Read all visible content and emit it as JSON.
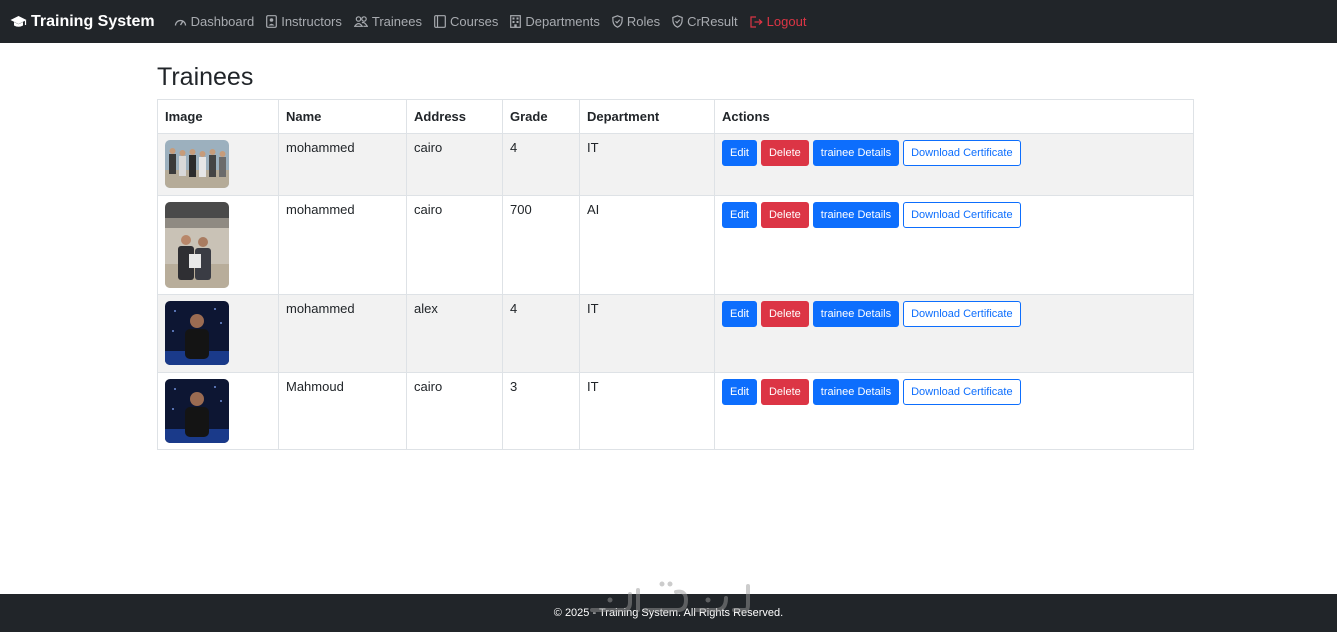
{
  "navbar": {
    "brand": "Training System",
    "items": [
      {
        "label": "Dashboard",
        "icon": "speedometer-icon"
      },
      {
        "label": "Instructors",
        "icon": "person-badge-icon"
      },
      {
        "label": "Trainees",
        "icon": "people-icon"
      },
      {
        "label": "Courses",
        "icon": "book-icon"
      },
      {
        "label": "Departments",
        "icon": "building-icon"
      },
      {
        "label": "Roles",
        "icon": "shield-icon"
      },
      {
        "label": "CrResult",
        "icon": "shield-icon"
      }
    ],
    "logout": "Logout"
  },
  "page": {
    "title": "Trainees"
  },
  "table": {
    "headers": [
      "Image",
      "Name",
      "Address",
      "Grade",
      "Department",
      "Actions"
    ],
    "rows": [
      {
        "name": "mohammed",
        "address": "cairo",
        "grade": "4",
        "department": "IT"
      },
      {
        "name": "mohammed",
        "address": "cairo",
        "grade": "700",
        "department": "AI"
      },
      {
        "name": "mohammed",
        "address": "alex",
        "grade": "4",
        "department": "IT"
      },
      {
        "name": "Mahmoud",
        "address": "cairo",
        "grade": "3",
        "department": "IT"
      }
    ],
    "actions": {
      "edit": "Edit",
      "delete": "Delete",
      "details": "trainee Details",
      "certificate": "Download Certificate"
    }
  },
  "footer": {
    "text": "© 2025 - Training System. All Rights Reserved."
  },
  "colors": {
    "navbar": "#212529",
    "primary": "#0d6efd",
    "danger": "#dc3545",
    "stripe": "#f2f2f2"
  }
}
